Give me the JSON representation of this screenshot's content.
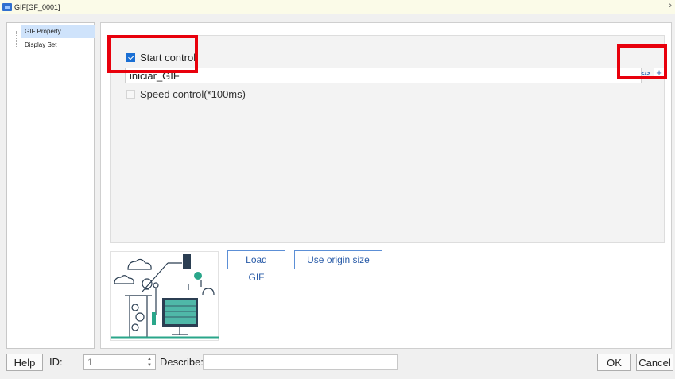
{
  "window": {
    "title": "GIF[GF_0001]"
  },
  "tree": {
    "items": [
      {
        "label": "GIF Property",
        "selected": true
      },
      {
        "label": "Display Set",
        "selected": false
      }
    ]
  },
  "property": {
    "start_control": {
      "label": "Start control",
      "checked": true
    },
    "start_field": {
      "value": "iniciar_GIF"
    },
    "speed_control": {
      "label": "Speed control(*100ms)",
      "checked": false
    }
  },
  "icons": {
    "script": "code-icon",
    "add": "plus-icon",
    "add_symbol": "+",
    "script_symbol": "</>",
    "chevron": "›"
  },
  "buttons": {
    "load_gif": "Load GIF",
    "use_origin_size": "Use origin size",
    "help": "Help",
    "ok": "OK",
    "cancel": "Cancel"
  },
  "footer": {
    "id_label": "ID:",
    "id_value": "1",
    "describe_label": "Describe:",
    "describe_value": ""
  },
  "colors": {
    "accent": "#1a6fd4",
    "highlight_box": "#e8000c",
    "selection": "#cfe3fb"
  }
}
